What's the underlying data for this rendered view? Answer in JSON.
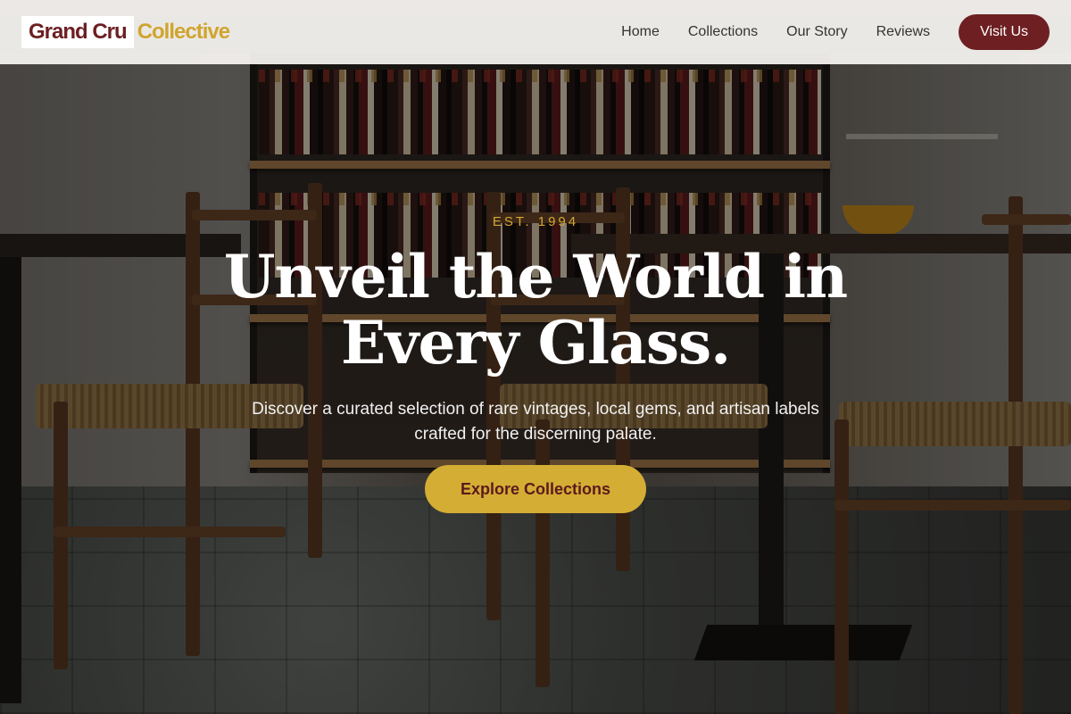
{
  "brand": {
    "name_part1": "Grand Cru",
    "name_part2": "Collective"
  },
  "nav": {
    "items": [
      {
        "label": "Home"
      },
      {
        "label": "Collections"
      },
      {
        "label": "Our Story"
      },
      {
        "label": "Reviews"
      }
    ],
    "cta_label": "Visit Us"
  },
  "hero": {
    "eyebrow": "EST. 1994",
    "title": "Unveil the World in Every Glass.",
    "subtitle": "Discover a curated selection of rare vintages, local gems, and artisan labels crafted for the discerning palate.",
    "cta_label": "Explore Collections"
  },
  "colors": {
    "primary": "#6d1f22",
    "accent": "#d4ad34",
    "nav_bg": "#f5f3f0",
    "text_light": "#ffffff"
  }
}
